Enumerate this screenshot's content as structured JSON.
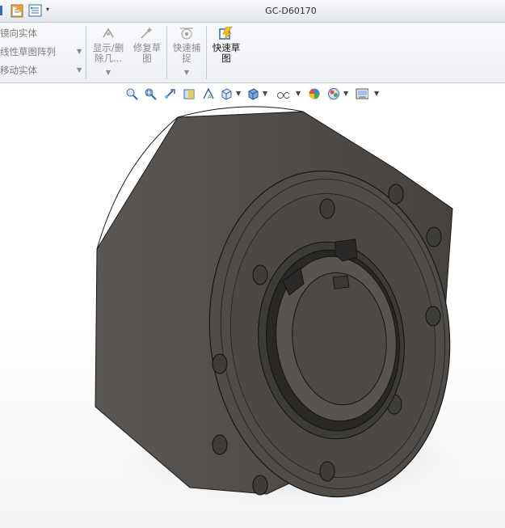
{
  "window": {
    "title": "GC-D60170"
  },
  "quick_access": {
    "dropdown": "▾"
  },
  "ribbon": {
    "left_items": [
      {
        "label": "镜向实体",
        "has_dropdown": false
      },
      {
        "label": "线性草图阵列",
        "has_dropdown": true
      },
      {
        "label": "移动实体",
        "has_dropdown": true
      }
    ],
    "buttons": {
      "show_delete": "显示/删\n除几...",
      "repair_sketch": "修复草\n图",
      "quick_snap": "快速捕\n捉",
      "quick_sketch": "快速草\n图"
    }
  },
  "icons": {
    "titlebar": [
      "toggle-icon",
      "options-clipboard-icon",
      "properties-list-icon"
    ],
    "hud": [
      "zoom-to-fit-icon",
      "zoom-to-area-icon",
      "previous-view-icon",
      "section-view-icon",
      "dynamic-annotation-icon",
      "view-orientation-icon",
      "display-style-icon",
      "hide-show-items-icon",
      "edit-appearance-icon",
      "apply-scene-icon",
      "view-settings-icon"
    ]
  },
  "colors": {
    "body": "#4a4845",
    "body_dark": "#3a3835",
    "face": "#55524f",
    "accent_yellow": "#f2c21b",
    "accent_blue": "#1c5fc6"
  }
}
